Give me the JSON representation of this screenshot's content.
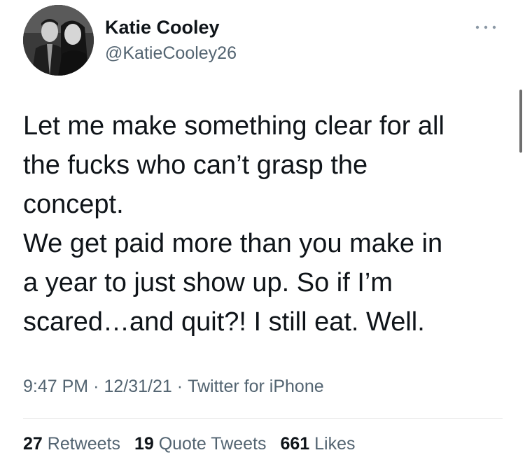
{
  "author": {
    "display_name": "Katie Cooley",
    "handle": "@KatieCooley26"
  },
  "tweet": {
    "lines": [
      "Let me make something clear for all",
      "the fucks who can’t grasp the",
      "concept.",
      "We get paid more than you make in",
      "a year to just show up. So if I’m",
      "scared…and quit?! I still eat. Well."
    ],
    "time": "9:47 PM",
    "date": "12/31/21",
    "separator": "·",
    "source": "Twitter for iPhone"
  },
  "stats": {
    "retweets": {
      "count": "27",
      "label": "Retweets"
    },
    "quote_tweets": {
      "count": "19",
      "label": "Quote Tweets"
    },
    "likes": {
      "count": "661",
      "label": "Likes"
    }
  },
  "icons": {
    "more": "more-options-icon",
    "avatar": "profile-photo"
  }
}
